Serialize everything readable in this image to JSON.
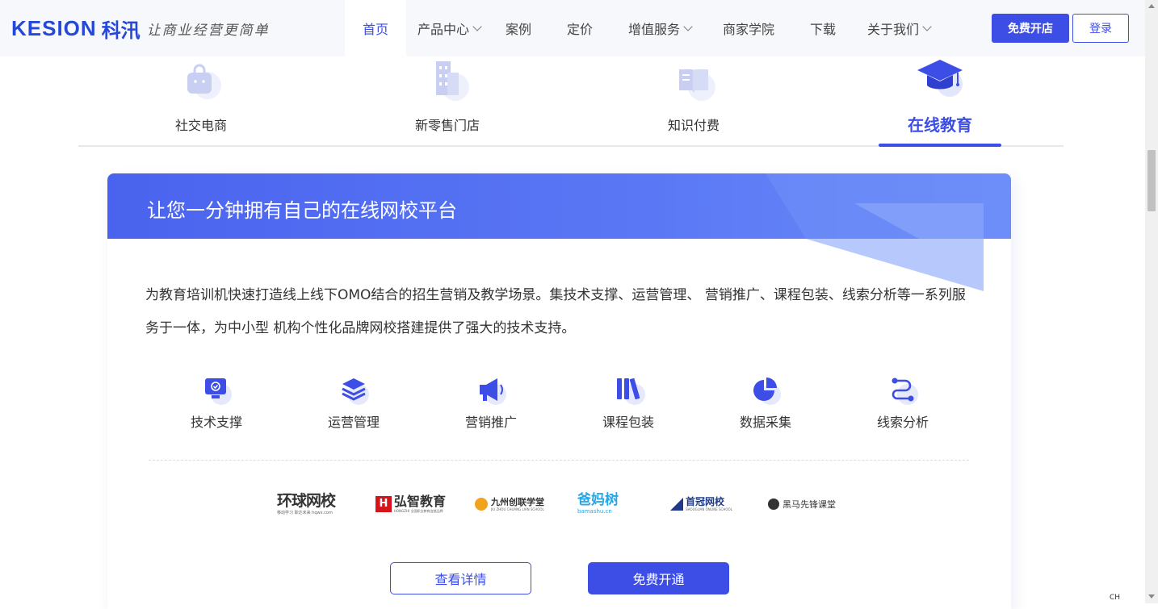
{
  "header": {
    "logo_en": "KESION",
    "logo_cn": "科汛",
    "slogan": "让商业经营更简单",
    "nav": [
      {
        "label": "首页",
        "active": true,
        "dropdown": false
      },
      {
        "label": "产品中心",
        "active": false,
        "dropdown": true
      },
      {
        "label": "案例",
        "active": false,
        "dropdown": false
      },
      {
        "label": "定价",
        "active": false,
        "dropdown": false
      },
      {
        "label": "增值服务",
        "active": false,
        "dropdown": true
      },
      {
        "label": "商家学院",
        "active": false,
        "dropdown": false
      },
      {
        "label": "下载",
        "active": false,
        "dropdown": false
      },
      {
        "label": "关于我们",
        "active": false,
        "dropdown": true
      }
    ],
    "open_store_label": "免费开店",
    "login_label": "登录"
  },
  "tabs": [
    {
      "label": "社交电商",
      "icon": "shopping-bag-icon",
      "active": false
    },
    {
      "label": "新零售门店",
      "icon": "building-icon",
      "active": false
    },
    {
      "label": "知识付费",
      "icon": "book-icon",
      "active": false
    },
    {
      "label": "在线教育",
      "icon": "graduation-cap-icon",
      "active": true
    }
  ],
  "card": {
    "title": "让您一分钟拥有自己的在线网校平台",
    "description": "为教育培训机快速打造线上线下OMO结合的招生营销及教学场景。集技术支撑、运营管理、 营销推广、课程包装、线索分析等一系列服务于一体，为中小型 机构个性化品牌网校搭建提供了强大的技术支持。",
    "features": [
      {
        "label": "技术支撑",
        "icon": "monitor-icon"
      },
      {
        "label": "运营管理",
        "icon": "layers-icon"
      },
      {
        "label": "营销推广",
        "icon": "megaphone-icon"
      },
      {
        "label": "课程包装",
        "icon": "books-icon"
      },
      {
        "label": "数据采集",
        "icon": "pie-chart-icon"
      },
      {
        "label": "线索分析",
        "icon": "route-icon"
      }
    ],
    "partners": [
      {
        "name": "环球网校",
        "sub": "移动学习 职达未来 hqwx.com"
      },
      {
        "name": "弘智教育",
        "sub": "HONGZHI 全国职业教育连锁品牌"
      },
      {
        "name": "九州创联学堂",
        "sub": "JIU ZHOU CHUANG LIAN SCHOOL"
      },
      {
        "name": "爸妈树",
        "sub": "bamashu.cn"
      },
      {
        "name": "首冠网校",
        "sub": "SHOUGUAN ONLINE SCHOOL"
      },
      {
        "name": "黑马先锋课堂",
        "sub": ""
      }
    ],
    "detail_button": "查看详情",
    "free_button": "免费开通"
  },
  "colors": {
    "accent": "#3d4ee6",
    "header_bg": "#f7f8fb",
    "banner_start": "#4a63ee",
    "banner_end": "#6b8cf8"
  },
  "tray": {
    "ime": "CH"
  }
}
